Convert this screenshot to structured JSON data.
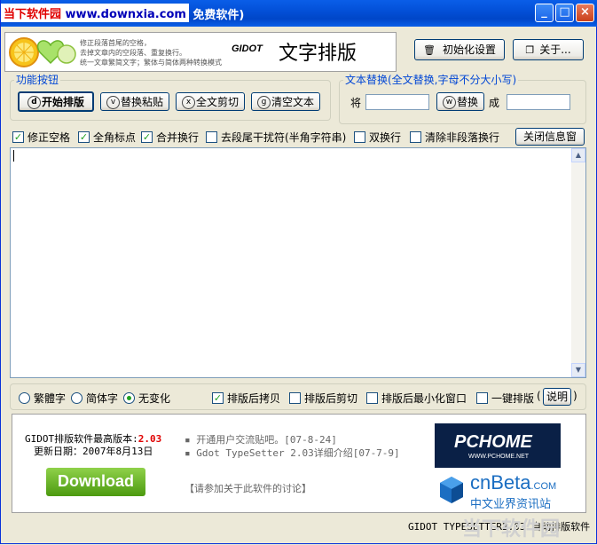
{
  "window": {
    "title": "当下软件园 www.downxia.com 免费软件)",
    "overlay_site": "当下软件园",
    "overlay_url": "www.downxia.com",
    "controls": {
      "minimize": "_",
      "maximize": "□",
      "close": "×"
    }
  },
  "banner": {
    "lines": [
      "修正段落首尾的空格，",
      "去掉文章内的空段落、重复换行。",
      "统一文章繁简文字；繁体与简体两种转换模式"
    ],
    "gidot": "GIDOT",
    "title": "文字排版"
  },
  "top_buttons": {
    "init": "初始化设置",
    "about": "关于..."
  },
  "function_group": {
    "label": "功能按钮",
    "buttons": [
      {
        "key": "d",
        "label": "开始排版"
      },
      {
        "key": "v",
        "label": "替换粘贴"
      },
      {
        "key": "x",
        "label": "全文剪切"
      },
      {
        "key": "g",
        "label": "清空文本"
      }
    ]
  },
  "replace_group": {
    "label": "文本替换(全文替换,字母不分大小写)",
    "from_label": "将",
    "to_label": "成",
    "from_value": "",
    "to_value": "",
    "button_key": "w",
    "button_label": "替换"
  },
  "options": [
    {
      "label": "修正空格",
      "checked": true
    },
    {
      "label": "全角标点",
      "checked": true
    },
    {
      "label": "合并换行",
      "checked": true
    },
    {
      "label": "去段尾干扰符(半角字符串)",
      "checked": false
    },
    {
      "label": "双换行",
      "checked": false
    },
    {
      "label": "清除非段落换行",
      "checked": false
    }
  ],
  "close_info_button": "关闭信息窗",
  "editor": {
    "content": ""
  },
  "conversion": [
    {
      "label": "繁體字",
      "selected": false
    },
    {
      "label": "简体字",
      "selected": false
    },
    {
      "label": "无变化",
      "selected": true
    }
  ],
  "after_options": [
    {
      "label": "排版后拷贝",
      "checked": true
    },
    {
      "label": "排版后剪切",
      "checked": false
    },
    {
      "label": "排版后最小化窗口",
      "checked": false
    },
    {
      "label": "一键排版",
      "checked": false
    }
  ],
  "help_button": "说明",
  "help_paren_open": "(",
  "help_paren_close": ")",
  "info": {
    "version_label": "GIDOT排版软件最高版本:",
    "version": "2.03",
    "update_label": "更新日期：",
    "update_date": "2007年8月13日",
    "download": "Download",
    "news": [
      "▪ 开通用户交流贴吧。[07-8-24]",
      "▪ Gdot TypeSetter 2.03详细介绍[07-7-9]"
    ],
    "discuss": "【请参加关于此软件的讨论】",
    "pchome_logo": "PCHOME",
    "pchome_url": "WWW.PCHOME.NET",
    "cnbeta_logo": "cnBeta",
    "cnbeta_com": ".COM",
    "cnbeta_sub": "中文业界资讯站"
  },
  "status": "GIDOT TYPESETTER2.03 自动排版软件",
  "watermark": "当下软件园",
  "colors": {
    "title_bar": "#0a5ee8",
    "group_label": "#0046d5",
    "version": "#e00000",
    "download": "#5aab1c"
  }
}
